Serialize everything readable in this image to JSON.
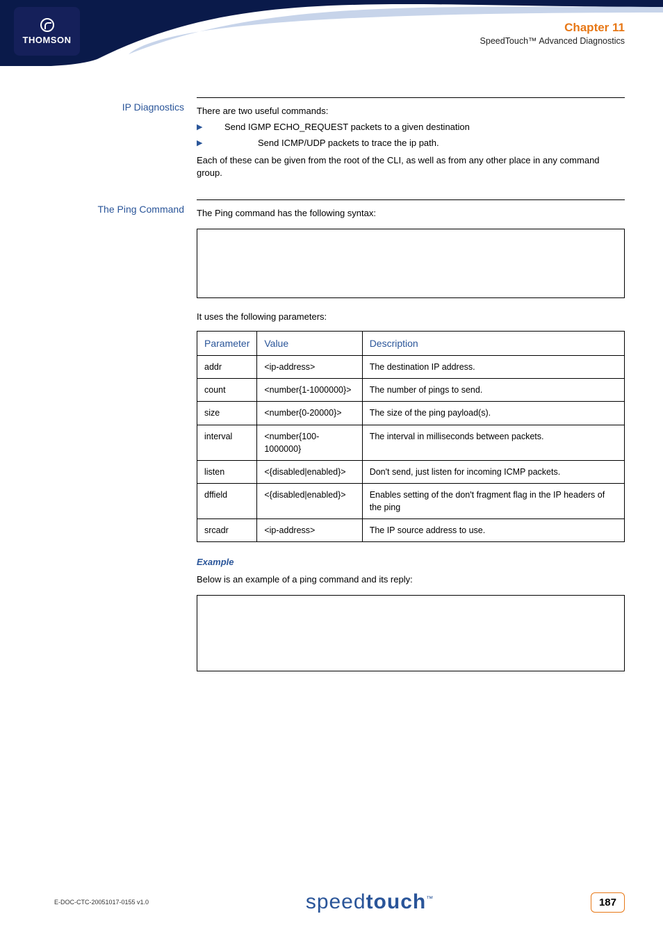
{
  "header": {
    "logo_text": "THOMSON",
    "chapter_title": "Chapter 11",
    "chapter_sub": "SpeedTouch™ Advanced Diagnostics"
  },
  "sections": {
    "ip_diag": {
      "label": "IP Diagnostics",
      "intro": "There are two useful commands:",
      "bullets": [
        "Send IGMP ECHO_REQUEST packets to a given destination",
        "Send ICMP/UDP packets to trace the ip path."
      ],
      "outro": "Each of these can be given from the root of the CLI, as well as from any other place in any command group."
    },
    "ping": {
      "label": "The Ping Command",
      "intro": "The Ping command has the following syntax:",
      "syntax_code": "",
      "params_intro": "It uses the following parameters:",
      "table": {
        "headers": [
          "Parameter",
          "Value",
          "Description"
        ],
        "rows": [
          {
            "p": "addr",
            "v": "<ip-address>",
            "d": "The destination IP address."
          },
          {
            "p": "count",
            "v": "<number{1-1000000}>",
            "d": "The number of pings to send."
          },
          {
            "p": "size",
            "v": "<number{0-20000}>",
            "d": "The size of the ping payload(s)."
          },
          {
            "p": "interval",
            "v": "<number{100-1000000}",
            "d": "The interval in milliseconds between packets."
          },
          {
            "p": "listen",
            "v": "<{disabled|enabled}>",
            "d": "Don't send, just listen for incoming ICMP packets."
          },
          {
            "p": "dffield",
            "v": "<{disabled|enabled}>",
            "d": "Enables setting of the don't fragment flag in the IP headers of the ping"
          },
          {
            "p": "srcadr",
            "v": "<ip-address>",
            "d": "The IP source address to use."
          }
        ]
      },
      "example_h": "Example",
      "example_intro": "Below is an example of a ping command and its reply:",
      "example_code": ""
    }
  },
  "footer": {
    "doc_id": "E-DOC-CTC-20051017-0155 v1.0",
    "brand_thin": "speed",
    "brand_bold": "touch",
    "page": "187"
  }
}
